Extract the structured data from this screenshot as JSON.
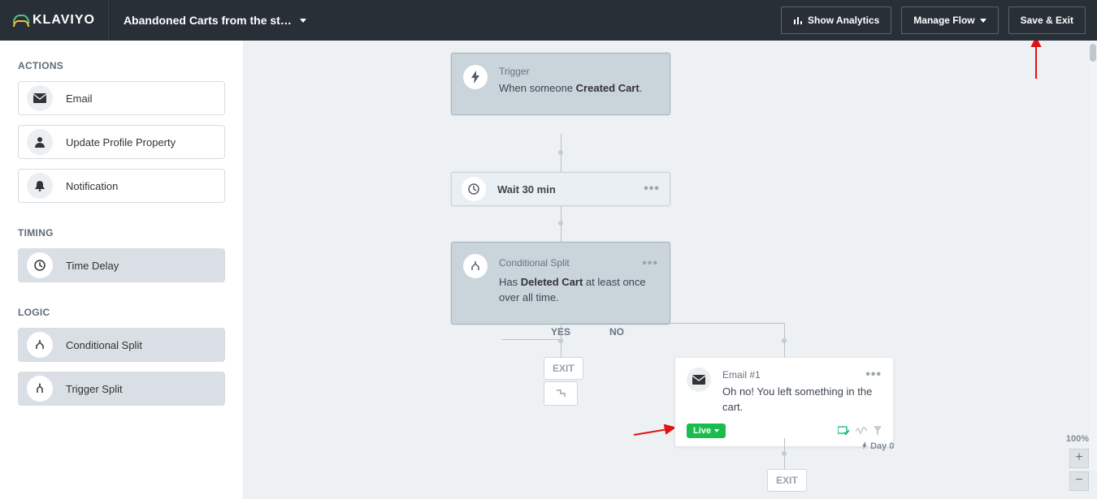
{
  "header": {
    "brand": "KLAVIYO",
    "flow_title": "Abandoned Carts from the st…",
    "show_analytics": "Show Analytics",
    "manage_flow": "Manage Flow",
    "save_exit": "Save & Exit"
  },
  "palette": {
    "actions_title": "ACTIONS",
    "email": "Email",
    "update_profile": "Update Profile Property",
    "notification": "Notification",
    "timing_title": "TIMING",
    "time_delay": "Time Delay",
    "logic_title": "LOGIC",
    "conditional_split": "Conditional Split",
    "trigger_split": "Trigger Split"
  },
  "flow": {
    "trigger_label": "Trigger",
    "trigger_pre": "When someone ",
    "trigger_event": "Created Cart",
    "trigger_post": ".",
    "wait_label": "Wait 30 min",
    "cond_label": "Conditional Split",
    "cond_pre": "Has ",
    "cond_event": "Deleted Cart",
    "cond_post": " at least once over all time.",
    "yes": "YES",
    "no": "NO",
    "exit": "EXIT",
    "email_label": "Email #1",
    "email_subject": "Oh no! You left something in the cart.",
    "live": "Live",
    "day_tag": "Day 0"
  },
  "zoom": {
    "pct": "100%",
    "plus": "+",
    "minus": "−"
  }
}
